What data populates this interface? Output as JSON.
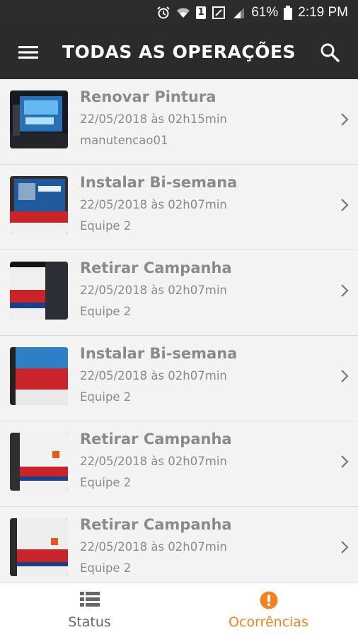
{
  "status_bar": {
    "battery": "61%",
    "time": "2:19 PM",
    "sim": "1"
  },
  "app_bar": {
    "title": "TODAS AS OPERAÇÕES"
  },
  "items": [
    {
      "title": "Renovar Pintura",
      "date": "22/05/2018 às 02h15min",
      "team": "manutencao01",
      "thumb": "blue-screen-billboard"
    },
    {
      "title": "Instalar Bi-semana",
      "date": "22/05/2018 às 02h07min",
      "team": "Equipe 2",
      "thumb": "bus-ad-panel"
    },
    {
      "title": "Retirar Campanha",
      "date": "22/05/2018 às 02h07min",
      "team": "Equipe 2",
      "thumb": "bus-red-panel"
    },
    {
      "title": "Instalar Bi-semana",
      "date": "22/05/2018 às 02h07min",
      "team": "Equipe 2",
      "thumb": "bus-blue-red"
    },
    {
      "title": "Retirar Campanha",
      "date": "22/05/2018 às 02h07min",
      "team": "Equipe 2",
      "thumb": "bus-white-red"
    },
    {
      "title": "Retirar Campanha",
      "date": "22/05/2018 às 02h07min",
      "team": "Equipe 2",
      "thumb": "bus-red-panel"
    }
  ],
  "bottom_nav": [
    {
      "label": "Status",
      "icon": "list-icon",
      "active": false
    },
    {
      "label": "Ocorrências",
      "icon": "alert-icon",
      "active": true
    }
  ],
  "colors": {
    "accent": "#f5811f",
    "app_bar": "#2b2b2b",
    "text_muted": "#8a8a8a",
    "nav_inactive": "#666666"
  }
}
